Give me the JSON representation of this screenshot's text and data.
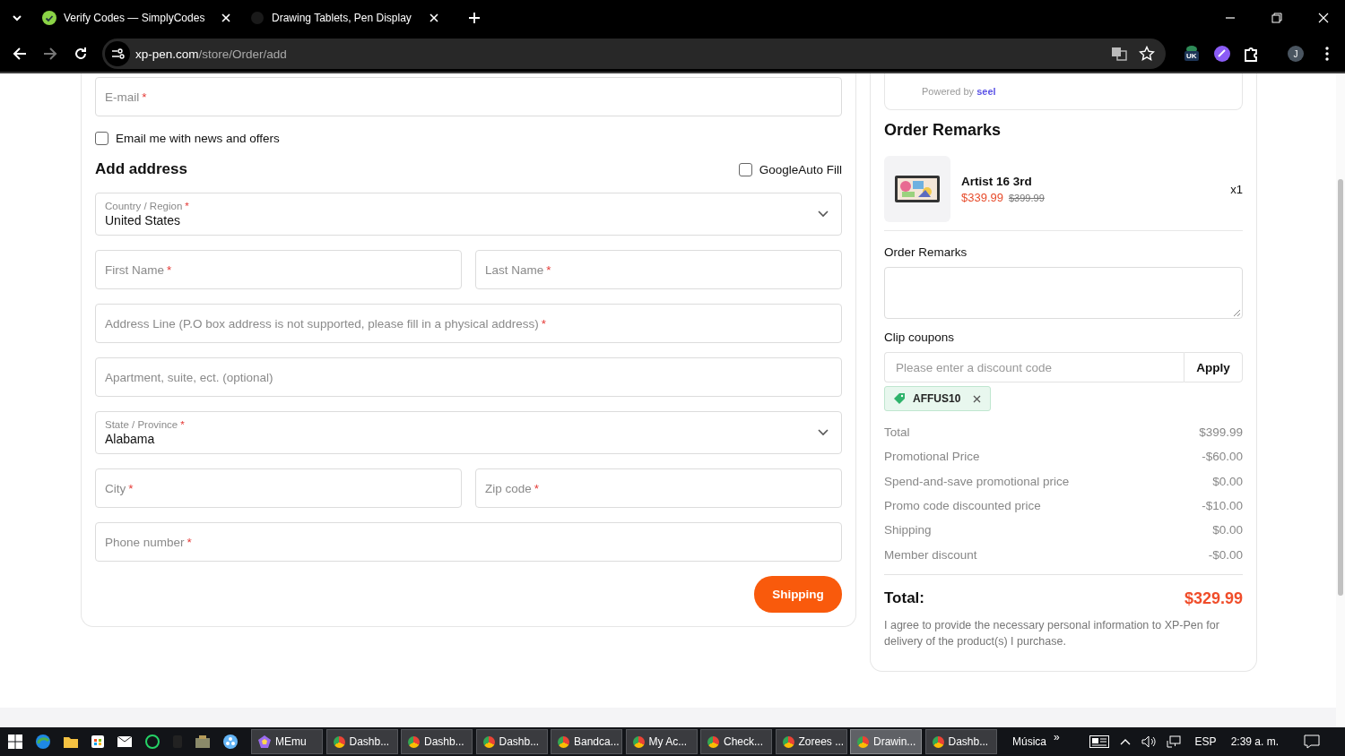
{
  "browser": {
    "tabs": [
      {
        "title": "Verify Codes — SimplyCodes"
      },
      {
        "title": "Drawing Tablets, Pen Display"
      }
    ],
    "url": {
      "host": "xp-pen.com",
      "path": "/store/Order/add"
    },
    "extension_badge": "UK",
    "profile_initial": "J"
  },
  "checkout": {
    "email": {
      "label": "E-mail",
      "mark": "*"
    },
    "newsletter": {
      "label": "Email me with news and offers",
      "checked": false
    },
    "address_heading": "Add address",
    "google_autofill": {
      "label": "GoogleAuto Fill",
      "checked": false
    },
    "field_rows": [
      [
        {
          "kind": "select",
          "label": "Country / Region",
          "mark": "*",
          "value": "United States"
        }
      ],
      [
        {
          "kind": "text",
          "label": "First Name",
          "mark": "*"
        },
        {
          "kind": "text",
          "label": "Last Name",
          "mark": "*"
        }
      ],
      [
        {
          "kind": "text",
          "label": "Address Line (P.O box address is not supported, please fill in a physical address)",
          "mark": "*"
        }
      ],
      [
        {
          "kind": "text",
          "label": "Apartment, suite, ect. (optional)"
        }
      ],
      [
        {
          "kind": "select",
          "label": "State / Province",
          "mark": "*",
          "value": "Alabama"
        }
      ],
      [
        {
          "kind": "text",
          "label": "City",
          "mark": "*"
        },
        {
          "kind": "text",
          "label": "Zip code",
          "mark": "*"
        }
      ],
      [
        {
          "kind": "text",
          "label": "Phone number",
          "mark": "*"
        }
      ]
    ],
    "submit": "Shipping"
  },
  "order": {
    "seel": {
      "prefix": "Powered by",
      "brand": "seel"
    },
    "heading": "Order Remarks",
    "items": [
      {
        "name": "Artist 16 3rd",
        "price": "$339.99",
        "original_price": "$399.99",
        "quantity": "x1"
      }
    ],
    "remarks_label": "Order Remarks",
    "coupons": {
      "label": "Clip coupons",
      "placeholder": "Please enter a discount code",
      "button": "Apply",
      "applied": [
        {
          "code": "AFFUS10"
        }
      ]
    },
    "summary": [
      {
        "label": "Total",
        "value": "$399.99"
      },
      {
        "label": "Promotional Price",
        "value": "-$60.00"
      },
      {
        "label": "Spend-and-save promotional price",
        "value": "$0.00"
      },
      {
        "label": "Promo code discounted price",
        "value": "-$10.00"
      },
      {
        "label": "Shipping",
        "value": "$0.00"
      },
      {
        "label": "Member discount",
        "value": "-$0.00"
      }
    ],
    "total": {
      "label": "Total:",
      "value": "$329.99"
    },
    "agreement": "I agree to provide the necessary personal information to XP-Pen for delivery of the product(s) I purchase."
  },
  "taskbar": {
    "apps": [
      {
        "label": "MEmu",
        "selected": false
      },
      {
        "label": "Dashb...",
        "selected": false
      },
      {
        "label": "Dashb...",
        "selected": false
      },
      {
        "label": "Dashb...",
        "selected": false
      },
      {
        "label": "Bandca...",
        "selected": false
      },
      {
        "label": "My Ac...",
        "selected": false
      },
      {
        "label": "Check...",
        "selected": false
      },
      {
        "label": "Zorees ...",
        "selected": false
      },
      {
        "label": "Drawin...",
        "selected": true
      },
      {
        "label": "Dashb...",
        "selected": false
      }
    ],
    "music": "Música",
    "overflow": "»",
    "language": "ESP",
    "time": "2:39 a. m."
  }
}
